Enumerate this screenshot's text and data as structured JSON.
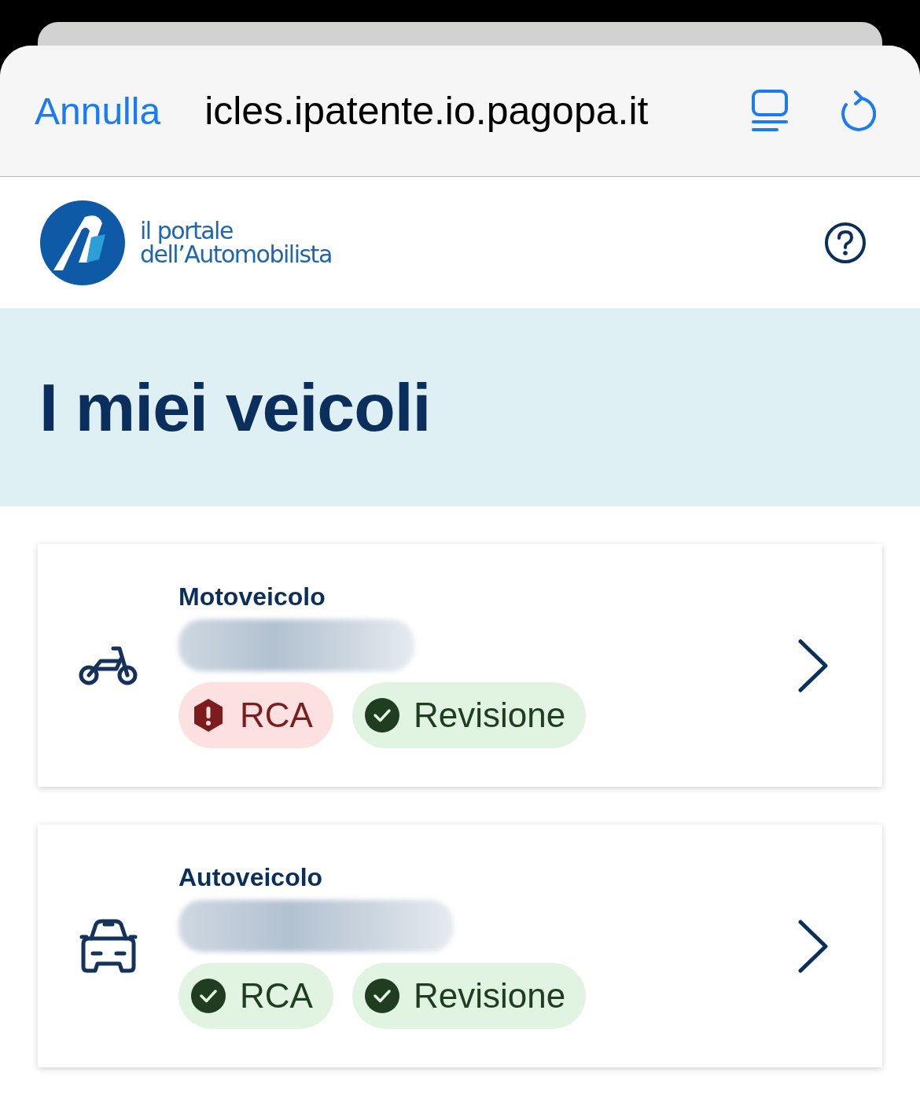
{
  "browser": {
    "cancel": "Annulla",
    "url": "icles.ipatente.io.pagopa.it"
  },
  "header": {
    "logo_line_1": "il portale",
    "logo_line_2": "dell’Automobilista"
  },
  "page": {
    "title": "I miei veicoli"
  },
  "vehicles": [
    {
      "kind": "moto",
      "type": "Motoveicolo",
      "badges": [
        {
          "label": "RCA",
          "kind": "error"
        },
        {
          "label": "Revisione",
          "kind": "ok"
        }
      ]
    },
    {
      "kind": "auto",
      "type": "Autoveicolo",
      "badges": [
        {
          "label": "RCA",
          "kind": "ok"
        },
        {
          "label": "Revisione",
          "kind": "ok"
        }
      ]
    }
  ]
}
